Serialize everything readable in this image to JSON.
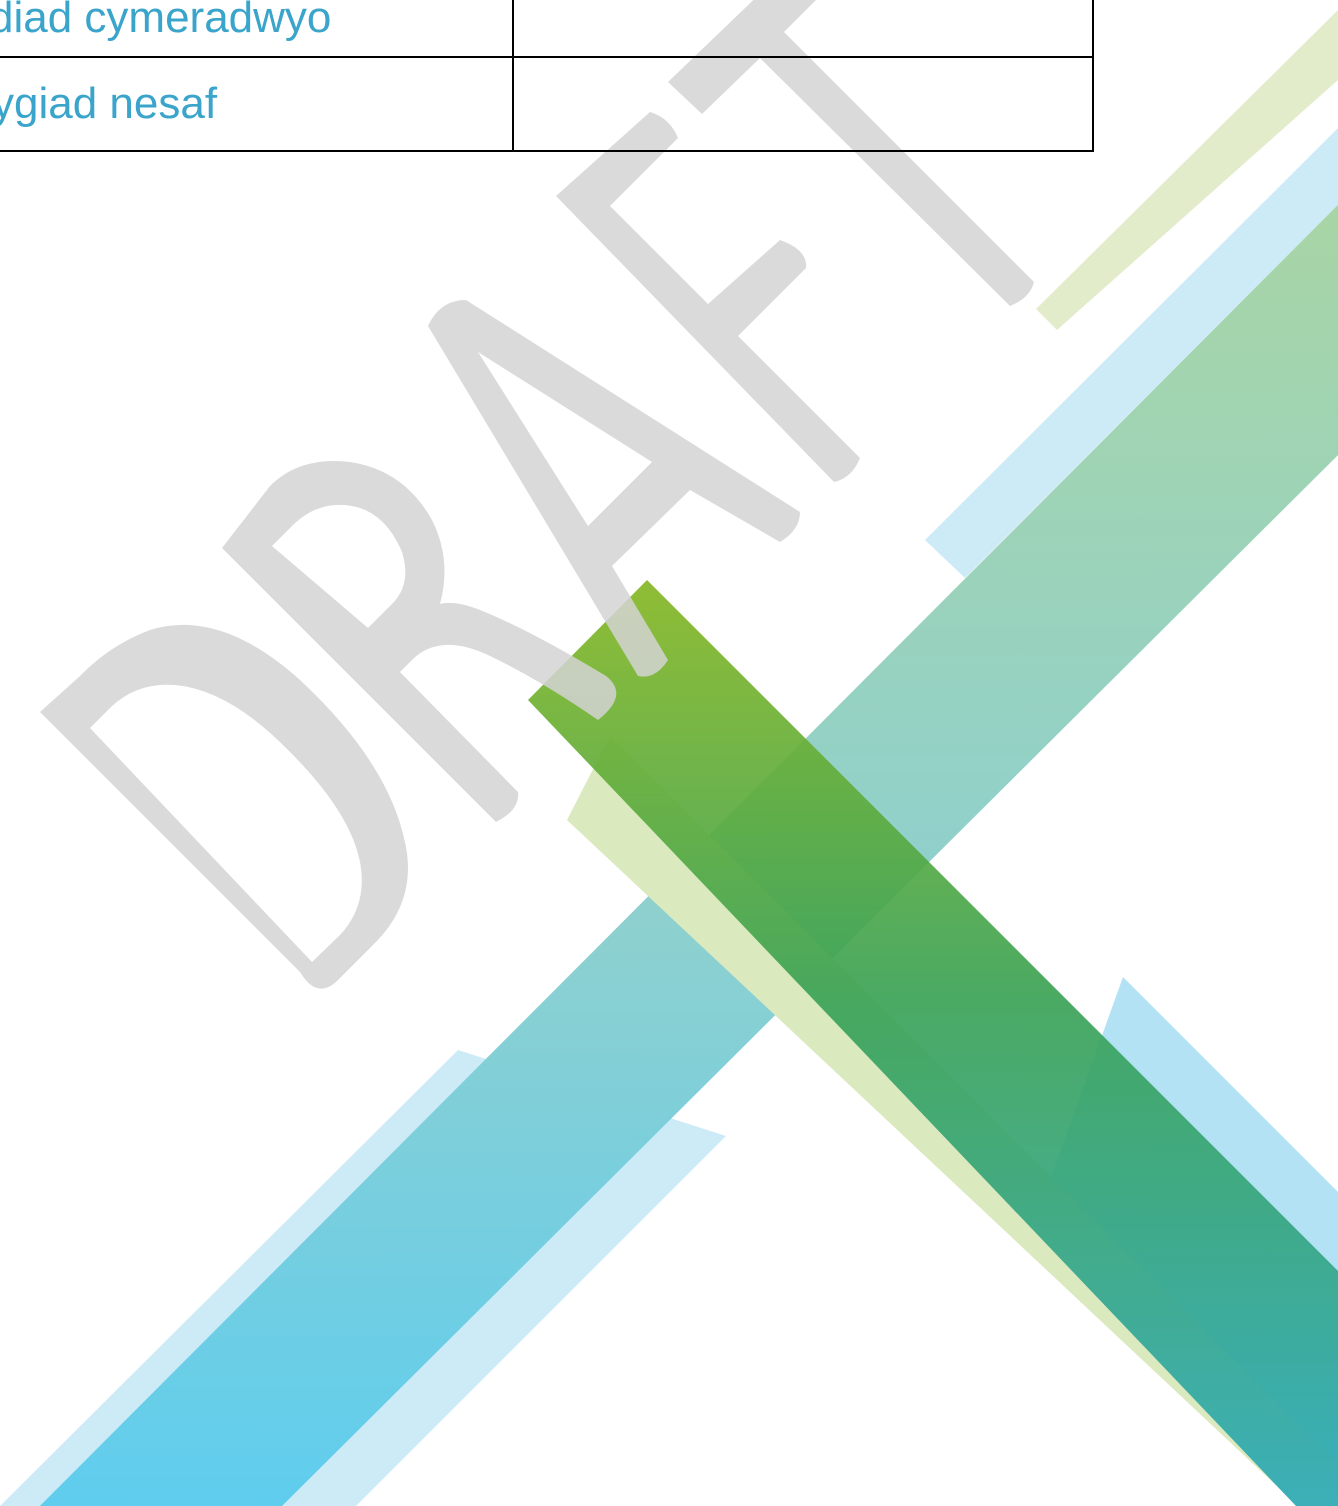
{
  "document_meta_table": {
    "rows": [
      {
        "label": "diad cymeradwyo",
        "value": ""
      },
      {
        "label": "ygiad nesaf",
        "value": ""
      }
    ]
  },
  "watermark": {
    "text": "DRAFT",
    "color": "#d9d9d9"
  },
  "colors": {
    "label_text": "#3aa4cb",
    "table_border": "#000000",
    "light_blue": "#cdeaf7",
    "light_green": "#dde9c0",
    "green_gradient_top": "#86b723",
    "green_gradient_bottom": "#2eaab8",
    "blue_gradient_top": "#a8d5a5",
    "blue_gradient_bottom": "#5fcdee"
  }
}
